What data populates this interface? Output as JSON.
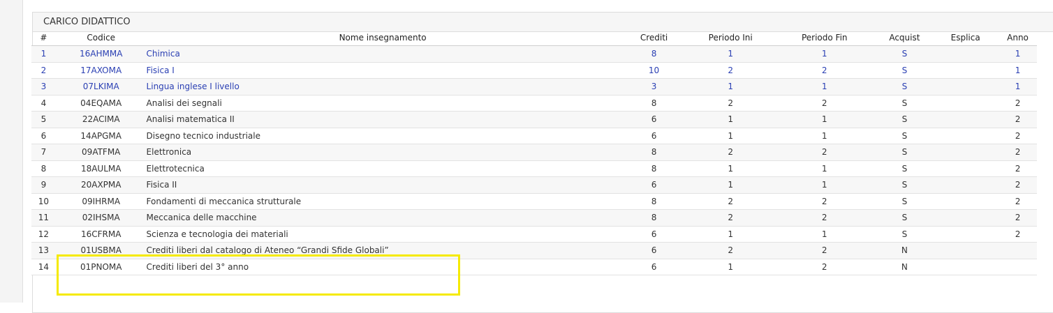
{
  "panel": {
    "title": "CARICO DIDATTICO"
  },
  "table": {
    "columns": [
      "#",
      "Codice",
      "Nome insegnamento",
      "Crediti",
      "Periodo Ini",
      "Periodo Fin",
      "Acquist",
      "Esplica",
      "Anno"
    ],
    "rows": [
      {
        "num": "1",
        "code": "16AHMMA",
        "name": "Chimica",
        "crediti": "8",
        "pini": "1",
        "pfin": "1",
        "acquist": "S",
        "esplica": "",
        "anno": "1",
        "linked": true
      },
      {
        "num": "2",
        "code": "17AXOMA",
        "name": "Fisica I",
        "crediti": "10",
        "pini": "2",
        "pfin": "2",
        "acquist": "S",
        "esplica": "",
        "anno": "1",
        "linked": true
      },
      {
        "num": "3",
        "code": "07LKIMA",
        "name": "Lingua inglese I livello",
        "crediti": "3",
        "pini": "1",
        "pfin": "1",
        "acquist": "S",
        "esplica": "",
        "anno": "1",
        "linked": true
      },
      {
        "num": "4",
        "code": "04EQAMA",
        "name": "Analisi dei segnali",
        "crediti": "8",
        "pini": "2",
        "pfin": "2",
        "acquist": "S",
        "esplica": "",
        "anno": "2",
        "linked": false
      },
      {
        "num": "5",
        "code": "22ACIMA",
        "name": "Analisi matematica II",
        "crediti": "6",
        "pini": "1",
        "pfin": "1",
        "acquist": "S",
        "esplica": "",
        "anno": "2",
        "linked": false
      },
      {
        "num": "6",
        "code": "14APGMA",
        "name": "Disegno tecnico industriale",
        "crediti": "6",
        "pini": "1",
        "pfin": "1",
        "acquist": "S",
        "esplica": "",
        "anno": "2",
        "linked": false
      },
      {
        "num": "7",
        "code": "09ATFMA",
        "name": "Elettronica",
        "crediti": "8",
        "pini": "2",
        "pfin": "2",
        "acquist": "S",
        "esplica": "",
        "anno": "2",
        "linked": false
      },
      {
        "num": "8",
        "code": "18AULMA",
        "name": "Elettrotecnica",
        "crediti": "8",
        "pini": "1",
        "pfin": "1",
        "acquist": "S",
        "esplica": "",
        "anno": "2",
        "linked": false
      },
      {
        "num": "9",
        "code": "20AXPMA",
        "name": "Fisica II",
        "crediti": "6",
        "pini": "1",
        "pfin": "1",
        "acquist": "S",
        "esplica": "",
        "anno": "2",
        "linked": false
      },
      {
        "num": "10",
        "code": "09IHRMA",
        "name": "Fondamenti di meccanica strutturale",
        "crediti": "8",
        "pini": "2",
        "pfin": "2",
        "acquist": "S",
        "esplica": "",
        "anno": "2",
        "linked": false
      },
      {
        "num": "11",
        "code": "02IHSMA",
        "name": "Meccanica delle macchine",
        "crediti": "8",
        "pini": "2",
        "pfin": "2",
        "acquist": "S",
        "esplica": "",
        "anno": "2",
        "linked": false
      },
      {
        "num": "12",
        "code": "16CFRMA",
        "name": "Scienza e tecnologia dei materiali",
        "crediti": "6",
        "pini": "1",
        "pfin": "1",
        "acquist": "S",
        "esplica": "",
        "anno": "2",
        "linked": false
      },
      {
        "num": "13",
        "code": "01USBMA",
        "name": "Crediti liberi dal catalogo di Ateneo “Grandi Sfide Globali”",
        "crediti": "6",
        "pini": "2",
        "pfin": "2",
        "acquist": "N",
        "esplica": "",
        "anno": "",
        "linked": false
      },
      {
        "num": "14",
        "code": "01PNOMA",
        "name": "Crediti liberi del 3° anno",
        "crediti": "6",
        "pini": "1",
        "pfin": "2",
        "acquist": "N",
        "esplica": "",
        "anno": "",
        "linked": false
      }
    ]
  },
  "colors": {
    "link": "#2a3fb3",
    "highlight": "#f5ea00",
    "row_alt": "#f7f7f7"
  }
}
